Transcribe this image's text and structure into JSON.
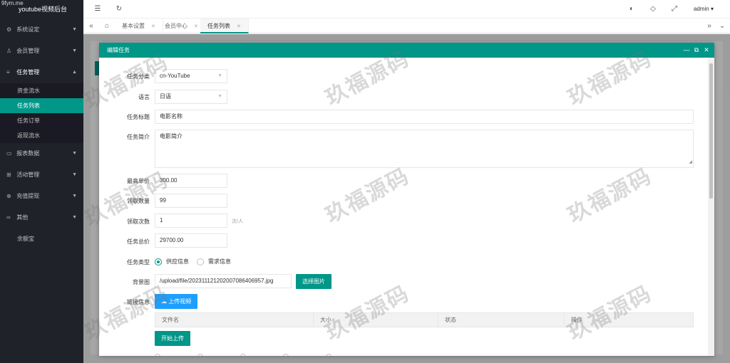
{
  "corner_watermark": "9fym.me",
  "app_title": "youtube视频后台",
  "sidebar": {
    "items": [
      {
        "label": "系统设定",
        "icon": "gear-icon",
        "glyph": "⚙"
      },
      {
        "label": "会员管理",
        "icon": "user-icon",
        "glyph": "♙"
      },
      {
        "label": "任务管理",
        "icon": "list-icon",
        "glyph": "≡",
        "open": true,
        "children": [
          {
            "label": "资金流水"
          },
          {
            "label": "任务列表",
            "active": true
          },
          {
            "label": "任务订单"
          },
          {
            "label": "返现流水"
          }
        ]
      },
      {
        "label": "报表数据",
        "icon": "report-icon",
        "glyph": "▭"
      },
      {
        "label": "活动管理",
        "icon": "activity-icon",
        "glyph": "⊞"
      },
      {
        "label": "充值提现",
        "icon": "money-icon",
        "glyph": "⊕"
      },
      {
        "label": "其他",
        "icon": "link-icon",
        "glyph": "∞"
      },
      {
        "label": "余额宝"
      }
    ]
  },
  "header": {
    "admin_label": "admin"
  },
  "tabs": [
    {
      "label": "基本设置"
    },
    {
      "label": "会员中心"
    },
    {
      "label": "任务列表",
      "active": true
    }
  ],
  "dialog": {
    "title": "编辑任务",
    "form": {
      "task_category": {
        "label": "任务分类",
        "value": "cn-YouTube"
      },
      "language": {
        "label": "语言",
        "value": "日语"
      },
      "task_title": {
        "label": "任务标题",
        "value": "电影名称"
      },
      "task_intro": {
        "label": "任务简介",
        "value": "电影简介"
      },
      "max_unit_price": {
        "label": "最高单价",
        "value": "300.00"
      },
      "claim_quantity": {
        "label": "领取数量",
        "value": "99"
      },
      "claim_times": {
        "label": "领取次数",
        "value": "1",
        "unit": "次/人"
      },
      "total_price": {
        "label": "任务总价",
        "value": "29700.00"
      },
      "task_type": {
        "label": "任务类型",
        "options": [
          "供应信息",
          "需求信息"
        ],
        "selected": "供应信息"
      },
      "background_image": {
        "label": "背景图",
        "value": "/upload/file/20231112120200708640695​7.jpg",
        "button": "选择图片"
      },
      "link_info": {
        "label": "链接信息",
        "upload_button": "上传视频"
      },
      "upload_table": {
        "columns": [
          "文件名",
          "大小",
          "状态",
          "操作"
        ]
      },
      "start_upload_button": "开始上传"
    }
  },
  "watermark_text": "玖福源码"
}
